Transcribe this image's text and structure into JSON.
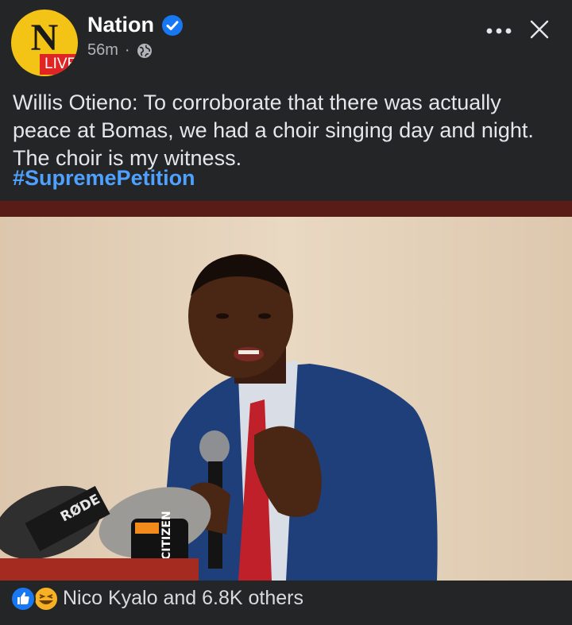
{
  "post": {
    "page_name": "Nation",
    "avatar_letter": "N",
    "avatar_badge": "LIVE",
    "time_ago": "56m",
    "separator": "·",
    "text": "Willis Otieno: To corroborate that there was actually\npeace at Bomas, we had a choir singing day and night.\nThe choir is my witness.",
    "hashtag": "#SupremePetition",
    "photo_labels": {
      "mic_brand_1": "RØDE",
      "mic_brand_2": "CITIZEN"
    },
    "reactions_text": "Nico Kyalo and 6.8K others"
  },
  "icons": [
    "verified-badge-icon",
    "globe-icon",
    "more-options-icon",
    "close-icon",
    "like-reaction-icon",
    "haha-reaction-icon"
  ],
  "colors": {
    "background": "#242526",
    "hashtag": "#4ea1ff",
    "verified": "#1877f2",
    "avatar": "#f3c316",
    "live_badge": "#e02424"
  }
}
